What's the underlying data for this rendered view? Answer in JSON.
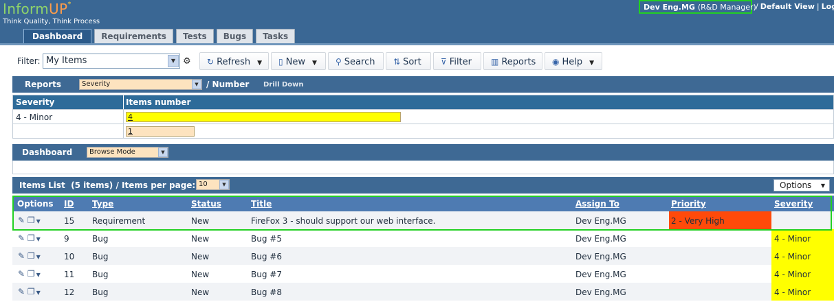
{
  "header": {
    "logo_main": "Inform",
    "logo_up": "UP",
    "logo_star": "*",
    "tagline": "Think Quality, Think Process",
    "user_name": "Dev Eng.MG",
    "user_role": "(R&D Manager)",
    "link_separator": "/",
    "default_view": "Default View",
    "link_separator2": "|",
    "logout": "Log"
  },
  "tabs": [
    "Dashboard",
    "Requirements",
    "Tests",
    "Bugs",
    "Tasks"
  ],
  "toolbar": {
    "filter_label": "Filter:",
    "filter_value": "My Items",
    "refresh": "Refresh",
    "new": "New",
    "search": "Search",
    "sort": "Sort",
    "filter": "Filter",
    "reports": "Reports",
    "help": "Help"
  },
  "reports": {
    "title": "Reports",
    "select_value": "Severity",
    "slash_label": "/ Number",
    "drill_down": "Drill Down",
    "col_severity": "Severity",
    "col_items": "Items number",
    "rows": [
      {
        "severity": "4 - Minor",
        "count": "4",
        "fill": 0.5,
        "color": "#ffff00"
      },
      {
        "severity": "",
        "count": "1",
        "fill": 0.125,
        "color": "#fde3bf"
      }
    ]
  },
  "dashboard": {
    "title": "Dashboard",
    "mode": "Browse Mode"
  },
  "items": {
    "title": "Items List  (5 items) / Items per page:",
    "per_page": "10",
    "options": "Options",
    "columns": {
      "options": "Options",
      "id": "ID",
      "type": "Type",
      "status": "Status",
      "title": "Title",
      "assign_to": "Assign To",
      "priority": "Priority",
      "severity": "Severity"
    },
    "rows": [
      {
        "id": "15",
        "type": "Requirement",
        "status": "New",
        "title": "FireFox 3 - should support our web interface.",
        "assign": "Dev Eng.MG",
        "priority": "2 - Very High",
        "severity": ""
      },
      {
        "id": "9",
        "type": "Bug",
        "status": "New",
        "title": "Bug #5",
        "assign": "Dev Eng.MG",
        "priority": "",
        "severity": "4 - Minor"
      },
      {
        "id": "10",
        "type": "Bug",
        "status": "New",
        "title": "Bug #6",
        "assign": "Dev Eng.MG",
        "priority": "",
        "severity": "4 - Minor"
      },
      {
        "id": "11",
        "type": "Bug",
        "status": "New",
        "title": "Bug #7",
        "assign": "Dev Eng.MG",
        "priority": "",
        "severity": "4 - Minor"
      },
      {
        "id": "12",
        "type": "Bug",
        "status": "New",
        "title": "Bug #8",
        "assign": "Dev Eng.MG",
        "priority": "",
        "severity": "4 - Minor"
      }
    ]
  },
  "colors": {
    "header_bg": "#3a6794",
    "priority_very_high": "#ff4a0a",
    "severity_minor": "#ffff00",
    "highlight": "#22d022"
  }
}
